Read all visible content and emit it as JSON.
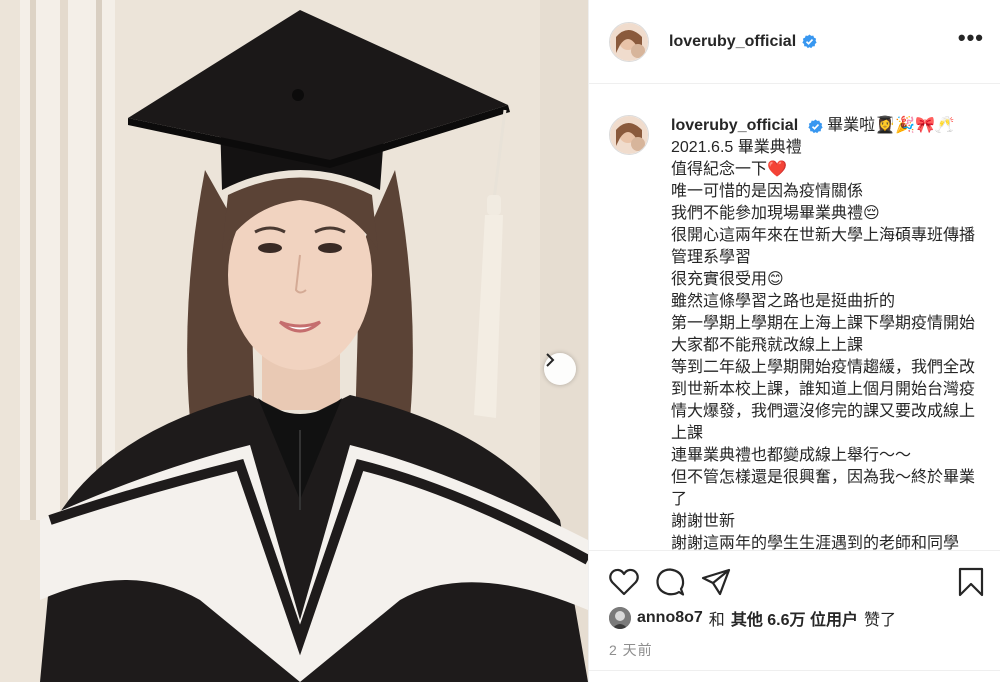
{
  "post": {
    "username": "loveruby_official",
    "verified": true,
    "more_label": "•••",
    "caption_head": "畢業啦👩‍🎓🎉🎀🥂",
    "caption_lines": [
      "2021.6.5 畢業典禮",
      "值得紀念一下❤️",
      "唯一可惜的是因為疫情關係",
      "我們不能參加現場畢業典禮😔",
      "很開心這兩年來在世新大學上海碩專班傳播管理系學習",
      "很充實很受用😊",
      "雖然這條學習之路也是挺曲折的",
      "第一學期上學期在上海上課下學期疫情開始大家都不能飛就改線上上課",
      "等到二年級上學期開始疫情趨緩，我們全改到世新本校上課，誰知道上個月開始台灣疫情大爆發，我們還沒修完的課又要改成線上上課",
      "連畢業典禮也都變成線上舉行～～",
      "但不管怎樣還是很興奮，因為我～終於畢業了",
      "謝謝世新",
      "謝謝這兩年的學生生涯遇到的老師和同學"
    ],
    "likes": {
      "user": "anno8o7",
      "and": "和",
      "others_count": "其他 6.6万 位用户",
      "liked": "赞了"
    },
    "time": "2 天前"
  },
  "icons": {
    "verified": "verified-badge-icon",
    "like": "heart-icon",
    "comment": "comment-icon",
    "share": "share-icon",
    "save": "bookmark-icon",
    "next": "chevron-right-icon",
    "more": "more-options-icon"
  },
  "colors": {
    "verified_blue": "#3897f0",
    "text": "#262626",
    "muted": "#8e8e8e",
    "border": "#efefef"
  }
}
